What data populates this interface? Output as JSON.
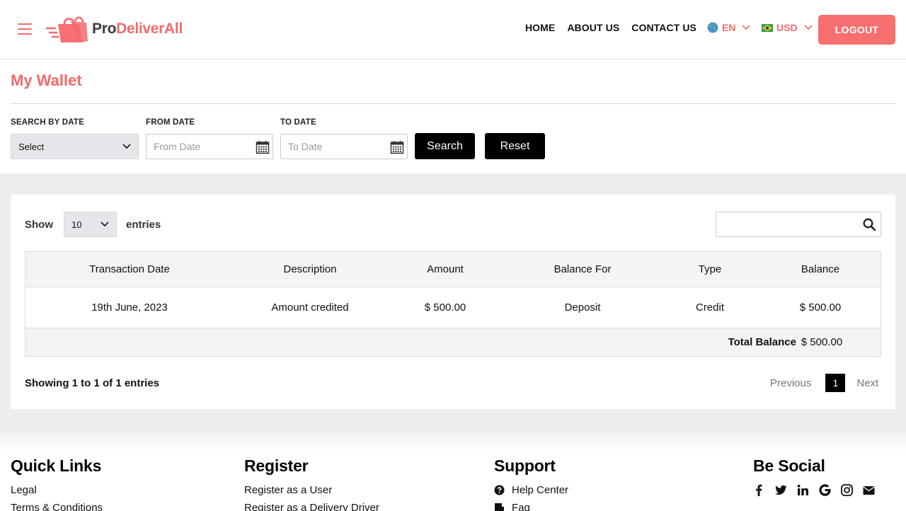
{
  "header": {
    "logo_prefix": "Pro",
    "logo_suffix": "DeliverAll",
    "nav": [
      "HOME",
      "ABOUT US",
      "CONTACT US"
    ],
    "language": "EN",
    "currency": "USD",
    "logout_label": "LOGOUT",
    "accent_color": "#f86f6f"
  },
  "page": {
    "title": "My Wallet"
  },
  "filters": {
    "search_by_date_label": "SEARCH BY DATE",
    "search_by_date_value": "Select",
    "from_date_label": "FROM DATE",
    "from_date_placeholder": "From Date",
    "to_date_label": "TO DATE",
    "to_date_placeholder": "To Date",
    "search_button": "Search",
    "reset_button": "Reset"
  },
  "table_controls": {
    "show_label": "Show",
    "entries_value": "10",
    "entries_label": "entries"
  },
  "table": {
    "columns": [
      "Transaction Date",
      "Description",
      "Amount",
      "Balance For",
      "Type",
      "Balance"
    ],
    "rows": [
      [
        "19th June, 2023",
        "Amount credited",
        "$ 500.00",
        "Deposit",
        "Credit",
        "$ 500.00"
      ]
    ],
    "total_label": "Total Balance",
    "total_value": "$ 500.00"
  },
  "pagination": {
    "info": "Showing 1 to 1 of 1 entries",
    "previous": "Previous",
    "current_page": "1",
    "next": "Next"
  },
  "footer": {
    "quick_links": {
      "title": "Quick Links",
      "items": [
        "Legal",
        "Terms & Conditions"
      ]
    },
    "register": {
      "title": "Register",
      "items": [
        "Register as a User",
        "Register as a Delivery Driver"
      ]
    },
    "support": {
      "title": "Support",
      "items": [
        "Help Center",
        "Faq"
      ]
    },
    "social": {
      "title": "Be Social",
      "icons": [
        "facebook-icon",
        "twitter-icon",
        "linkedin-icon",
        "google-icon",
        "instagram-icon",
        "email-icon"
      ]
    }
  }
}
